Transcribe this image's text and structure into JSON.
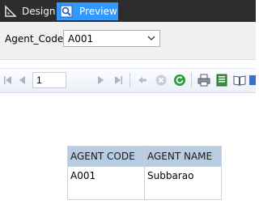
{
  "tabs": [
    {
      "label": "Design",
      "icon": "ruler-triangle-icon"
    },
    {
      "label": "Preview",
      "icon": "magnifier-icon",
      "active": true
    }
  ],
  "colors": {
    "tab_bar": "#2d2d30",
    "active_tab": "#3399ff",
    "header_fill": "#b8cce4"
  },
  "parameter": {
    "label": "Agent_Code",
    "value": "A001"
  },
  "toolbar": {
    "page": "1"
  },
  "report": {
    "columns": [
      "AGENT CODE",
      "AGENT NAME"
    ],
    "rows": [
      [
        "A001",
        "Subbarao"
      ]
    ]
  }
}
